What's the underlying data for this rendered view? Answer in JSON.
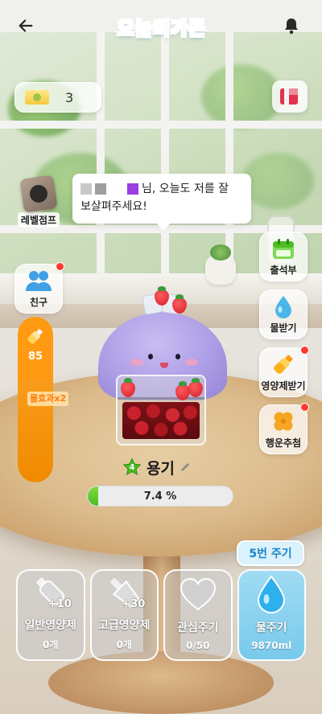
{
  "header": {
    "title": "오늘의가든"
  },
  "coupon": {
    "count": "3"
  },
  "level_jump": {
    "label": "레벨점프"
  },
  "speech": {
    "line1": "님, 오늘도 저를 잘",
    "line2": "보살펴주세요!"
  },
  "left_menu": {
    "friends_label": "친구"
  },
  "right_menu": {
    "attendance_label": "출석부",
    "water_receive_label": "물받기",
    "nutrient_receive_label": "영양제받기",
    "luck_label": "행운추첨"
  },
  "gauge": {
    "value": "85",
    "fill_fraction": 1.0,
    "badge": "물효과x2"
  },
  "plant": {
    "level": "4",
    "name": "용기",
    "progress_label": "7.4 %",
    "progress_percent": 7.4
  },
  "water_five_badge": "5번 주기",
  "actions": [
    {
      "plus": "+10",
      "title": "일반영양제",
      "sub": "0개"
    },
    {
      "plus": "+30",
      "title": "고급영양제",
      "sub": "0개"
    },
    {
      "title": "관심주기",
      "sub": "0/50"
    },
    {
      "title": "물주기",
      "sub": "9870ml"
    }
  ],
  "colors": {
    "accent_blue": "#1a83c9",
    "gauge_orange": "#ff9a12",
    "progress_green": "#4cbc22",
    "notification_red": "#ff3b30",
    "water_card": "#79c9ec"
  },
  "icons": {
    "back": "arrow-left-icon",
    "bell": "bell-icon",
    "coupon": "ticket-icon",
    "gift": "gift-box-icon",
    "friends": "people-icon",
    "attendance": "calendar-icon",
    "water_receive": "water-drop-icon",
    "nutrient_receive": "nutrient-bottle-icon",
    "luck": "four-leaf-clover-icon",
    "level_star": "star-icon",
    "edit": "pencil-icon",
    "heart": "heart-icon"
  }
}
